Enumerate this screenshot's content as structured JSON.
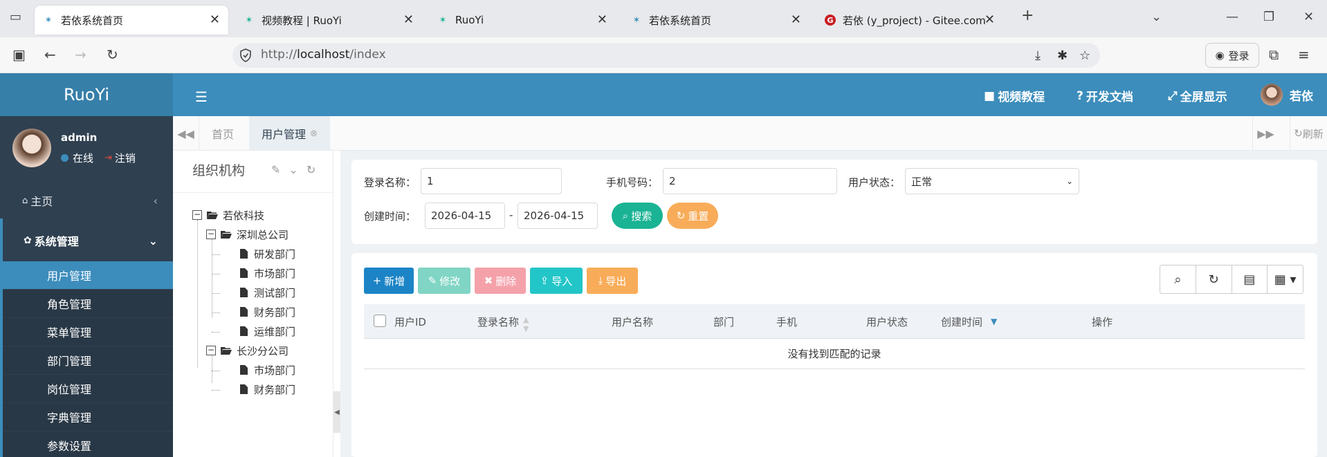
{
  "browser": {
    "tabs": [
      {
        "title": "若依系统首页",
        "active": true
      },
      {
        "title": "视频教程 | RuoYi",
        "active": false
      },
      {
        "title": "RuoYi",
        "active": false
      },
      {
        "title": "若依系统首页",
        "active": false
      },
      {
        "title": "若依 (y_project) - Gitee.com",
        "active": false
      }
    ],
    "url_prefix": "http://",
    "url_host": "localhost",
    "url_path": "/index",
    "login_label": "登录"
  },
  "app": {
    "logo": "RuoYi",
    "header_links": {
      "video": "视频教程",
      "docs": "开发文档",
      "fullscreen": "全屏显示",
      "user": "若依"
    },
    "sidebar": {
      "username": "admin",
      "online": "在线",
      "logout": "注销",
      "home": "主页",
      "system": "系统管理",
      "sub_items": [
        "用户管理",
        "角色管理",
        "菜单管理",
        "部门管理",
        "岗位管理",
        "字典管理",
        "参数设置"
      ]
    },
    "content_tabs": [
      "首页",
      "用户管理"
    ],
    "refresh_label": "刷新",
    "tree": {
      "title": "组织机构",
      "root": "若依科技",
      "branch1": "深圳总公司",
      "branch1_children": [
        "研发部门",
        "市场部门",
        "测试部门",
        "财务部门",
        "运维部门"
      ],
      "branch2": "长沙分公司",
      "branch2_children": [
        "市场部门",
        "财务部门"
      ]
    },
    "search": {
      "login_name_label": "登录名称：",
      "login_name_value": "1",
      "phone_label": "手机号码：",
      "phone_value": "2",
      "status_label": "用户状态：",
      "status_value": "正常",
      "created_label": "创建时间：",
      "date_from": "2026-04-15",
      "date_sep": "-",
      "date_to": "2026-04-15",
      "search_btn": "搜索",
      "reset_btn": "重置"
    },
    "toolbar": {
      "add": "新增",
      "edit": "修改",
      "delete": "删除",
      "import": "导入",
      "export": "导出"
    },
    "table": {
      "columns": [
        "用户ID",
        "登录名称",
        "用户名称",
        "部门",
        "手机",
        "用户状态",
        "创建时间",
        "操作"
      ],
      "empty": "没有找到匹配的记录"
    }
  },
  "colors": {
    "header": "#3c8dbc",
    "logo_bg": "#367fa9",
    "sidebar": "#2f4050",
    "primary": "#1c84c6",
    "success": "#1ab394",
    "warning": "#f8ac59",
    "danger": "#ed5565",
    "info": "#23c6c8"
  }
}
